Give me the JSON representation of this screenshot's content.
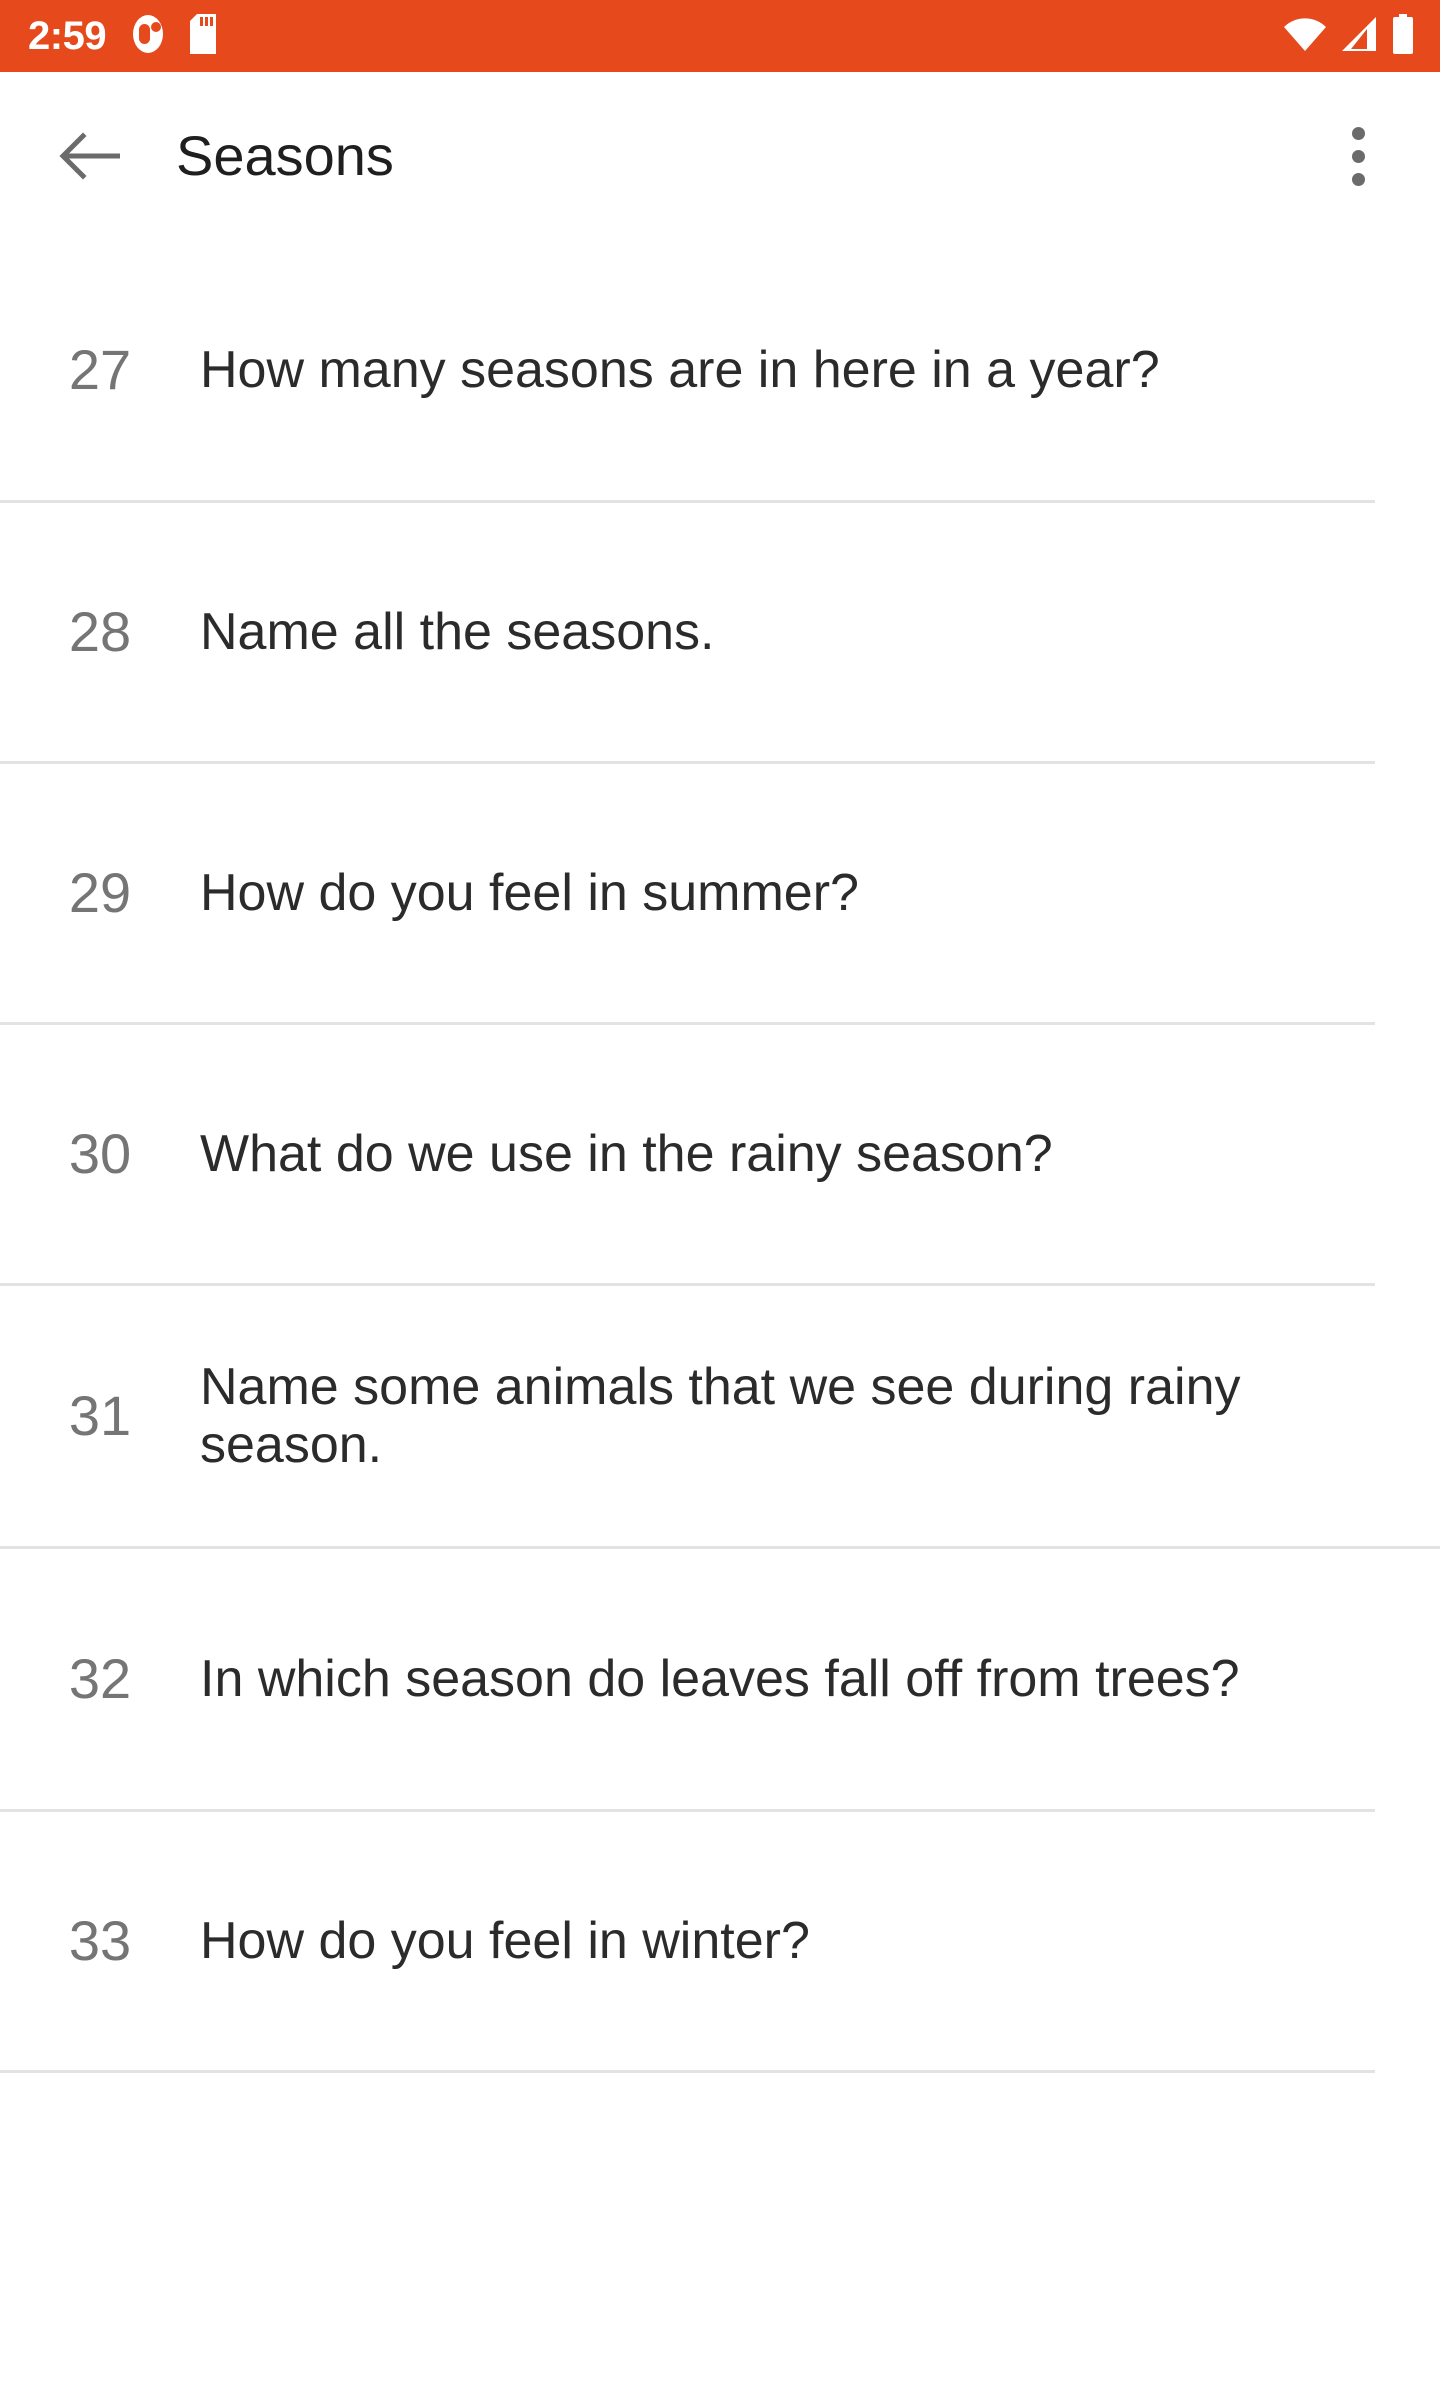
{
  "status_bar": {
    "background_color": "#E5491C",
    "time": "2:59",
    "icons": [
      {
        "name": "notification-badge-icon"
      },
      {
        "name": "sd-card-icon"
      },
      {
        "name": "wifi-icon"
      },
      {
        "name": "cellular-signal-icon"
      },
      {
        "name": "battery-icon"
      }
    ]
  },
  "app_bar": {
    "back_label": "←",
    "title": "Seasons",
    "overflow_label": "More options"
  },
  "list": {
    "accent_color": "#E5491C",
    "index_color": "#757575",
    "text_color": "#2b2b2b",
    "items": [
      {
        "index": "27",
        "question": "How many seasons are in here in a year?"
      },
      {
        "index": "28",
        "question": "Name all the seasons."
      },
      {
        "index": "29",
        "question": "How do you feel in summer?"
      },
      {
        "index": "30",
        "question": "What do we use in the rainy season?"
      },
      {
        "index": "31",
        "question": "Name some animals that we see during rainy season."
      },
      {
        "index": "32",
        "question": "In which season do leaves fall off from trees?"
      },
      {
        "index": "33",
        "question": "How do you feel in winter?"
      }
    ]
  }
}
